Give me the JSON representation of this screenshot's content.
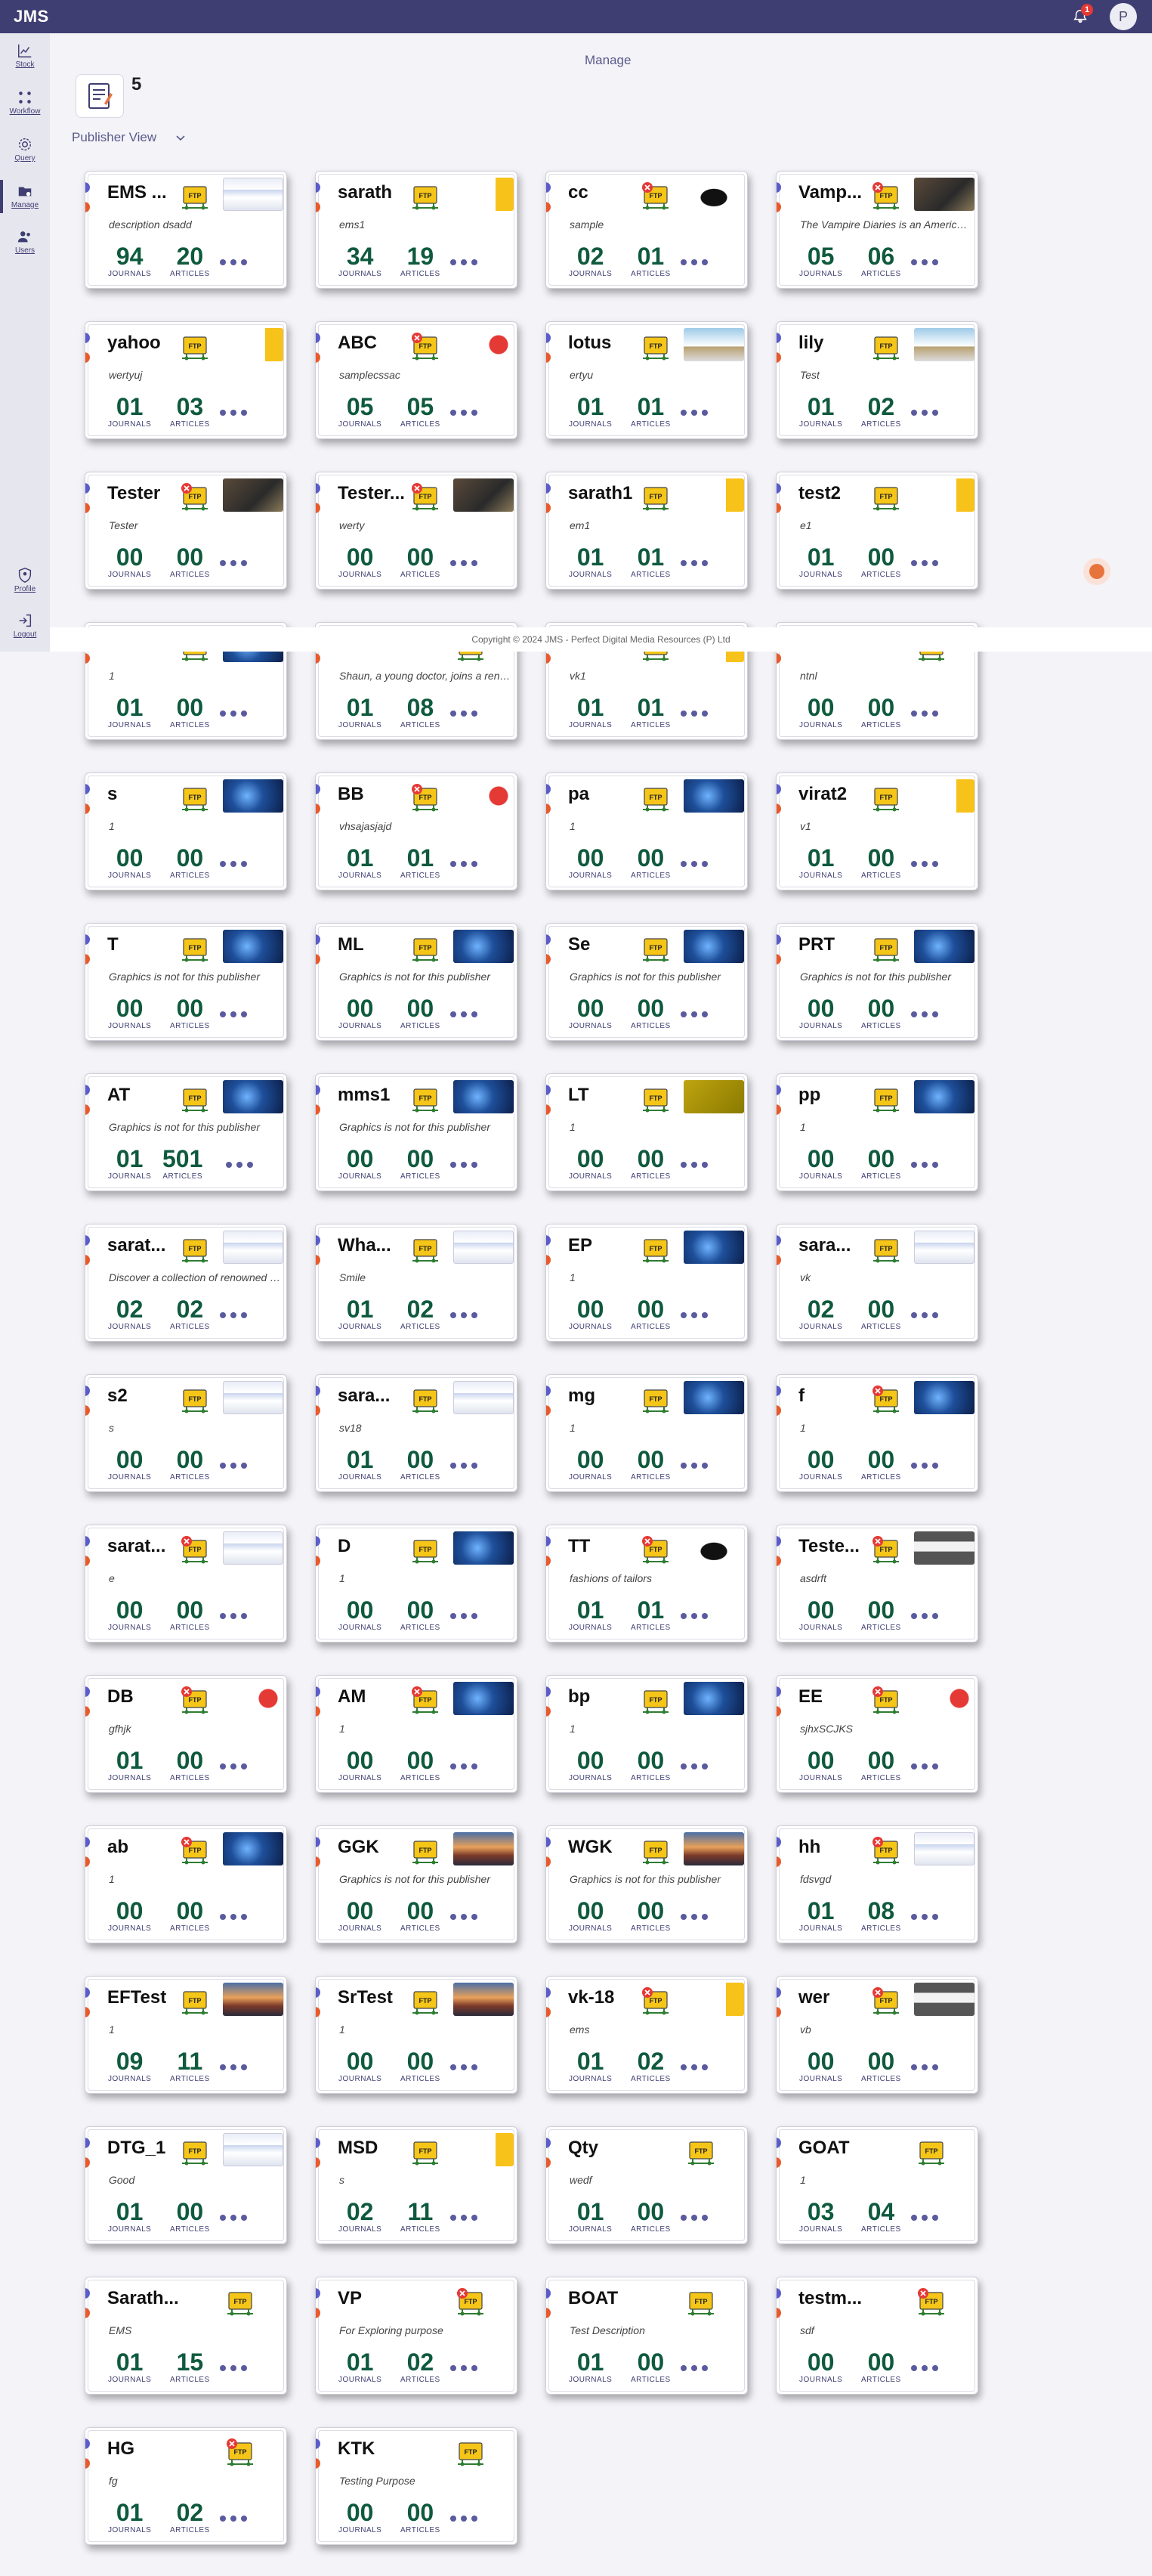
{
  "app": {
    "title": "JMS",
    "notification_count": "1",
    "avatar_letter": "P"
  },
  "sidebar": [
    {
      "key": "stock",
      "label": "Stock",
      "icon": "chart-line-icon"
    },
    {
      "key": "workflow",
      "label": "Workflow",
      "icon": "workflow-icon"
    },
    {
      "key": "query",
      "label": "Query",
      "icon": "gear-icon"
    },
    {
      "key": "manage",
      "label": "Manage",
      "icon": "folder-manage-icon",
      "active": true
    },
    {
      "key": "users",
      "label": "Users",
      "icon": "users-icon"
    },
    {
      "key": "profile",
      "label": "Profile",
      "icon": "shield-profile-icon"
    },
    {
      "key": "logout",
      "label": "Logout",
      "icon": "logout-icon"
    }
  ],
  "page": {
    "title": "Manage",
    "count": "5",
    "view_selector": "Publisher View",
    "copyright": "Copyright © 2024 JMS - Perfect Digital Media Resources (P) Ltd"
  },
  "labels": {
    "journals": "JOURNALS",
    "articles": "ARTICLES"
  },
  "publishers": [
    {
      "name": "EMS ...",
      "desc": "description dsadd",
      "journals": "94",
      "articles": "20",
      "ftp_error": false,
      "thumb": "screenshot"
    },
    {
      "name": "sarath",
      "desc": "ems1",
      "journals": "34",
      "articles": "19",
      "ftp_error": false,
      "thumb": "yellow"
    },
    {
      "name": "cc",
      "desc": "sample",
      "journals": "02",
      "articles": "01",
      "ftp_error": true,
      "thumb": "bat"
    },
    {
      "name": "Vamp...",
      "desc": "The Vampire Diaries is an American...",
      "journals": "05",
      "articles": "06",
      "ftp_error": true,
      "thumb": "dark"
    },
    {
      "name": "yahoo",
      "desc": "wertyuj",
      "journals": "01",
      "articles": "03",
      "ftp_error": false,
      "thumb": "yellow"
    },
    {
      "name": "ABC",
      "desc": "samplecssac",
      "journals": "05",
      "articles": "05",
      "ftp_error": true,
      "thumb": "red-logo"
    },
    {
      "name": "lotus",
      "desc": "ertyu",
      "journals": "01",
      "articles": "01",
      "ftp_error": false,
      "thumb": "building"
    },
    {
      "name": "lily",
      "desc": "Test",
      "journals": "01",
      "articles": "02",
      "ftp_error": false,
      "thumb": "building"
    },
    {
      "name": "Tester",
      "desc": "Tester",
      "journals": "00",
      "articles": "00",
      "ftp_error": true,
      "thumb": "dark"
    },
    {
      "name": "Tester...",
      "desc": "werty",
      "journals": "00",
      "articles": "00",
      "ftp_error": true,
      "thumb": "dark"
    },
    {
      "name": "sarath1",
      "desc": "em1",
      "journals": "01",
      "articles": "01",
      "ftp_error": false,
      "thumb": "yellow"
    },
    {
      "name": "test2",
      "desc": "e1",
      "journals": "01",
      "articles": "00",
      "ftp_error": false,
      "thumb": "yellow"
    },
    {
      "name": "",
      "desc": "1",
      "journals": "01",
      "articles": "00",
      "ftp_error": false,
      "thumb": "blue"
    },
    {
      "name": "",
      "desc": "Shaun, a young doctor, joins a reno...",
      "journals": "01",
      "articles": "08",
      "ftp_error": false,
      "thumb": "none"
    },
    {
      "name": "",
      "desc": "vk1",
      "journals": "01",
      "articles": "01",
      "ftp_error": false,
      "thumb": "yellow"
    },
    {
      "name": "",
      "desc": "ntnl",
      "journals": "00",
      "articles": "00",
      "ftp_error": false,
      "thumb": "none"
    },
    {
      "name": "s",
      "desc": "1",
      "journals": "00",
      "articles": "00",
      "ftp_error": false,
      "thumb": "blue"
    },
    {
      "name": "BB",
      "desc": "vhsajasjajd",
      "journals": "01",
      "articles": "01",
      "ftp_error": true,
      "thumb": "red-logo"
    },
    {
      "name": "pa",
      "desc": "1",
      "journals": "00",
      "articles": "00",
      "ftp_error": false,
      "thumb": "blue"
    },
    {
      "name": "virat2",
      "desc": "v1",
      "journals": "01",
      "articles": "00",
      "ftp_error": false,
      "thumb": "yellow"
    },
    {
      "name": "T",
      "desc": "Graphics is not for this publisher",
      "journals": "00",
      "articles": "00",
      "ftp_error": false,
      "thumb": "blue"
    },
    {
      "name": "ML",
      "desc": "Graphics is not for this publisher",
      "journals": "00",
      "articles": "00",
      "ftp_error": false,
      "thumb": "blue"
    },
    {
      "name": "Se",
      "desc": "Graphics is not for this publisher",
      "journals": "00",
      "articles": "00",
      "ftp_error": false,
      "thumb": "blue"
    },
    {
      "name": "PRT",
      "desc": "Graphics is not for this publisher",
      "journals": "00",
      "articles": "00",
      "ftp_error": false,
      "thumb": "blue"
    },
    {
      "name": "AT",
      "desc": "Graphics is not for this publisher",
      "journals": "01",
      "articles": "501",
      "ftp_error": false,
      "thumb": "blue"
    },
    {
      "name": "mms1",
      "desc": "Graphics is not for this publisher",
      "journals": "00",
      "articles": "00",
      "ftp_error": false,
      "thumb": "blue"
    },
    {
      "name": "LT",
      "desc": "1",
      "journals": "00",
      "articles": "00",
      "ftp_error": false,
      "thumb": "olive"
    },
    {
      "name": "pp",
      "desc": "1",
      "journals": "00",
      "articles": "00",
      "ftp_error": false,
      "thumb": "blue"
    },
    {
      "name": "sarat...",
      "desc": "Discover a collection of renowned br...",
      "journals": "02",
      "articles": "02",
      "ftp_error": false,
      "thumb": "screenshot"
    },
    {
      "name": "Wha...",
      "desc": "Smile",
      "journals": "01",
      "articles": "02",
      "ftp_error": false,
      "thumb": "screenshot"
    },
    {
      "name": "EP",
      "desc": "1",
      "journals": "00",
      "articles": "00",
      "ftp_error": false,
      "thumb": "blue"
    },
    {
      "name": "sara...",
      "desc": "vk",
      "journals": "02",
      "articles": "00",
      "ftp_error": false,
      "thumb": "screenshot"
    },
    {
      "name": "s2",
      "desc": "s",
      "journals": "00",
      "articles": "00",
      "ftp_error": false,
      "thumb": "screenshot"
    },
    {
      "name": "sara...",
      "desc": "sv18",
      "journals": "01",
      "articles": "00",
      "ftp_error": false,
      "thumb": "screenshot"
    },
    {
      "name": "mg",
      "desc": "1",
      "journals": "00",
      "articles": "00",
      "ftp_error": false,
      "thumb": "blue"
    },
    {
      "name": "f",
      "desc": "1",
      "journals": "00",
      "articles": "00",
      "ftp_error": true,
      "thumb": "blue"
    },
    {
      "name": "sarat...",
      "desc": "e",
      "journals": "00",
      "articles": "00",
      "ftp_error": true,
      "thumb": "screenshot"
    },
    {
      "name": "D",
      "desc": "1",
      "journals": "00",
      "articles": "00",
      "ftp_error": false,
      "thumb": "blue"
    },
    {
      "name": "TT",
      "desc": "fashions of tailors",
      "journals": "01",
      "articles": "01",
      "ftp_error": true,
      "thumb": "bat"
    },
    {
      "name": "Teste...",
      "desc": "asdrft",
      "journals": "00",
      "articles": "00",
      "ftp_error": true,
      "thumb": "gray"
    },
    {
      "name": "DB",
      "desc": "gfhjk",
      "journals": "01",
      "articles": "00",
      "ftp_error": true,
      "thumb": "red-logo"
    },
    {
      "name": "AM",
      "desc": "1",
      "journals": "00",
      "articles": "00",
      "ftp_error": true,
      "thumb": "blue"
    },
    {
      "name": "bp",
      "desc": "1",
      "journals": "00",
      "articles": "00",
      "ftp_error": false,
      "thumb": "blue"
    },
    {
      "name": "EE",
      "desc": "sjhxSCJKS",
      "journals": "00",
      "articles": "00",
      "ftp_error": true,
      "thumb": "red-logo"
    },
    {
      "name": "ab",
      "desc": "1",
      "journals": "00",
      "articles": "00",
      "ftp_error": true,
      "thumb": "blue"
    },
    {
      "name": "GGK",
      "desc": "Graphics is not for this publisher",
      "journals": "00",
      "articles": "00",
      "ftp_error": false,
      "thumb": "sunset"
    },
    {
      "name": "WGK",
      "desc": "Graphics is not for this publisher",
      "journals": "00",
      "articles": "00",
      "ftp_error": false,
      "thumb": "sunset"
    },
    {
      "name": "hh",
      "desc": "fdsvgd",
      "journals": "01",
      "articles": "08",
      "ftp_error": true,
      "thumb": "screenshot"
    },
    {
      "name": "EFTest",
      "desc": "1",
      "journals": "09",
      "articles": "11",
      "ftp_error": false,
      "thumb": "sunset"
    },
    {
      "name": "SrTest",
      "desc": "1",
      "journals": "00",
      "articles": "00",
      "ftp_error": false,
      "thumb": "sunset"
    },
    {
      "name": "vk-18",
      "desc": "ems",
      "journals": "01",
      "articles": "02",
      "ftp_error": true,
      "thumb": "yellow"
    },
    {
      "name": "wer",
      "desc": "vb",
      "journals": "00",
      "articles": "00",
      "ftp_error": true,
      "thumb": "gray"
    },
    {
      "name": "DTG_1",
      "desc": "Good",
      "journals": "01",
      "articles": "00",
      "ftp_error": false,
      "thumb": "screenshot"
    },
    {
      "name": "MSD",
      "desc": "s",
      "journals": "02",
      "articles": "11",
      "ftp_error": false,
      "thumb": "yellow"
    },
    {
      "name": "Qty",
      "desc": "wedf",
      "journals": "01",
      "articles": "00",
      "ftp_error": false,
      "thumb": "none"
    },
    {
      "name": "GOAT",
      "desc": "1",
      "journals": "03",
      "articles": "04",
      "ftp_error": false,
      "thumb": "none"
    },
    {
      "name": "Sarath...",
      "desc": "EMS",
      "journals": "01",
      "articles": "15",
      "ftp_error": false,
      "thumb": "none"
    },
    {
      "name": "VP",
      "desc": "For Exploring purpose",
      "journals": "01",
      "articles": "02",
      "ftp_error": true,
      "thumb": "none"
    },
    {
      "name": "BOAT",
      "desc": "Test Description",
      "journals": "01",
      "articles": "00",
      "ftp_error": false,
      "thumb": "none"
    },
    {
      "name": "testm...",
      "desc": "sdf",
      "journals": "00",
      "articles": "00",
      "ftp_error": true,
      "thumb": "none"
    },
    {
      "name": "HG",
      "desc": "fg",
      "journals": "01",
      "articles": "02",
      "ftp_error": true,
      "thumb": "none"
    },
    {
      "name": "KTK",
      "desc": "Testing Purpose",
      "journals": "00",
      "articles": "00",
      "ftp_error": false,
      "thumb": "none"
    }
  ]
}
